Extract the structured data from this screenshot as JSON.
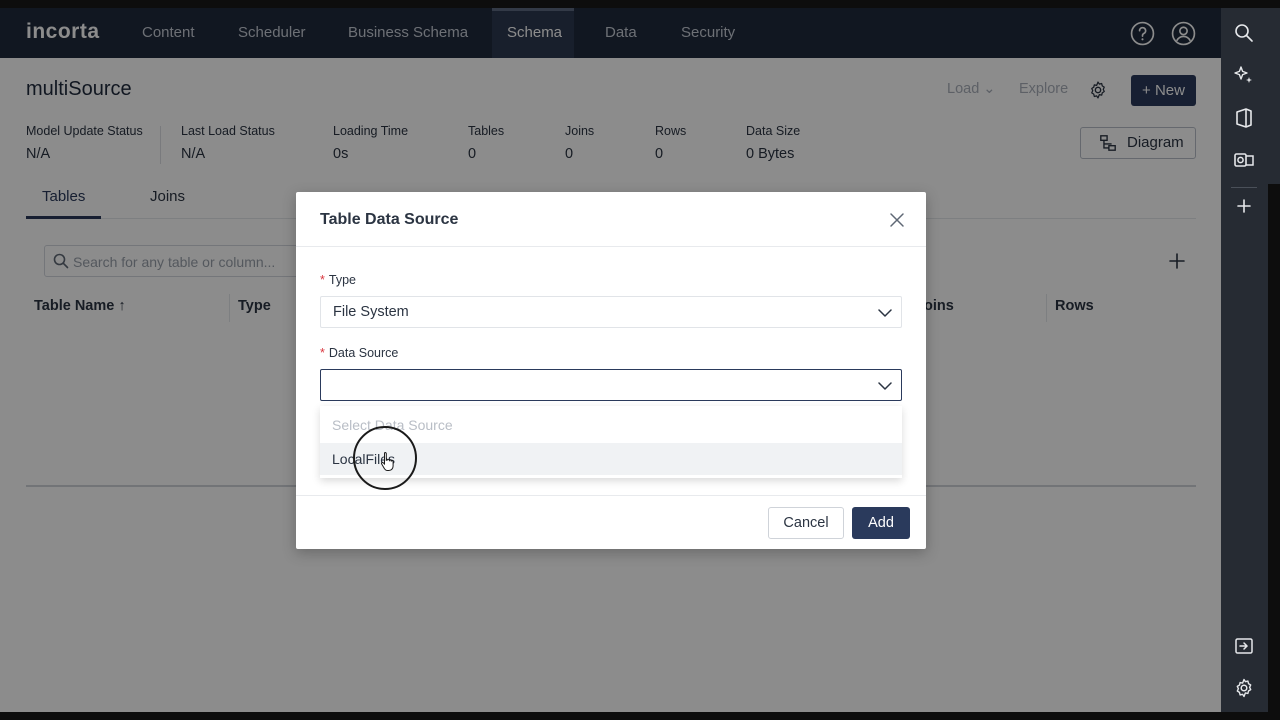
{
  "nav": {
    "logo": "incorta",
    "items": [
      "Content",
      "Scheduler",
      "Business Schema",
      "Schema",
      "Data",
      "Security"
    ],
    "active": "Schema"
  },
  "header": {
    "title": "multiSource",
    "load_label": "Load",
    "explore_label": "Explore",
    "new_label": "New"
  },
  "stats": [
    {
      "label": "Model Update Status",
      "value": "N/A"
    },
    {
      "label": "Last Load Status",
      "value": "N/A"
    },
    {
      "label": "Loading Time",
      "value": "0s"
    },
    {
      "label": "Tables",
      "value": "0"
    },
    {
      "label": "Joins",
      "value": "0"
    },
    {
      "label": "Rows",
      "value": "0"
    },
    {
      "label": "Data Size",
      "value": "0 Bytes"
    }
  ],
  "diagram_label": "Diagram",
  "tabs": [
    "Tables",
    "Joins"
  ],
  "search": {
    "placeholder": "Search for any table or column..."
  },
  "table": {
    "headers": [
      "Table Name",
      "Type",
      "Joins",
      "Rows"
    ],
    "visible_fragments": {
      "joins": "oins"
    }
  },
  "modal": {
    "title": "Table Data Source",
    "type_label": "Type",
    "type_value": "File System",
    "source_label": "Data Source",
    "source_value": "",
    "dropdown": {
      "placeholder": "Select Data Source",
      "options": [
        "LocalFiles"
      ]
    },
    "cancel_label": "Cancel",
    "add_label": "Add"
  },
  "colors": {
    "nav_bg": "#1f2a3d",
    "primary": "#2a3a5c",
    "required": "#d9363e",
    "rail_bg": "#262b33"
  }
}
